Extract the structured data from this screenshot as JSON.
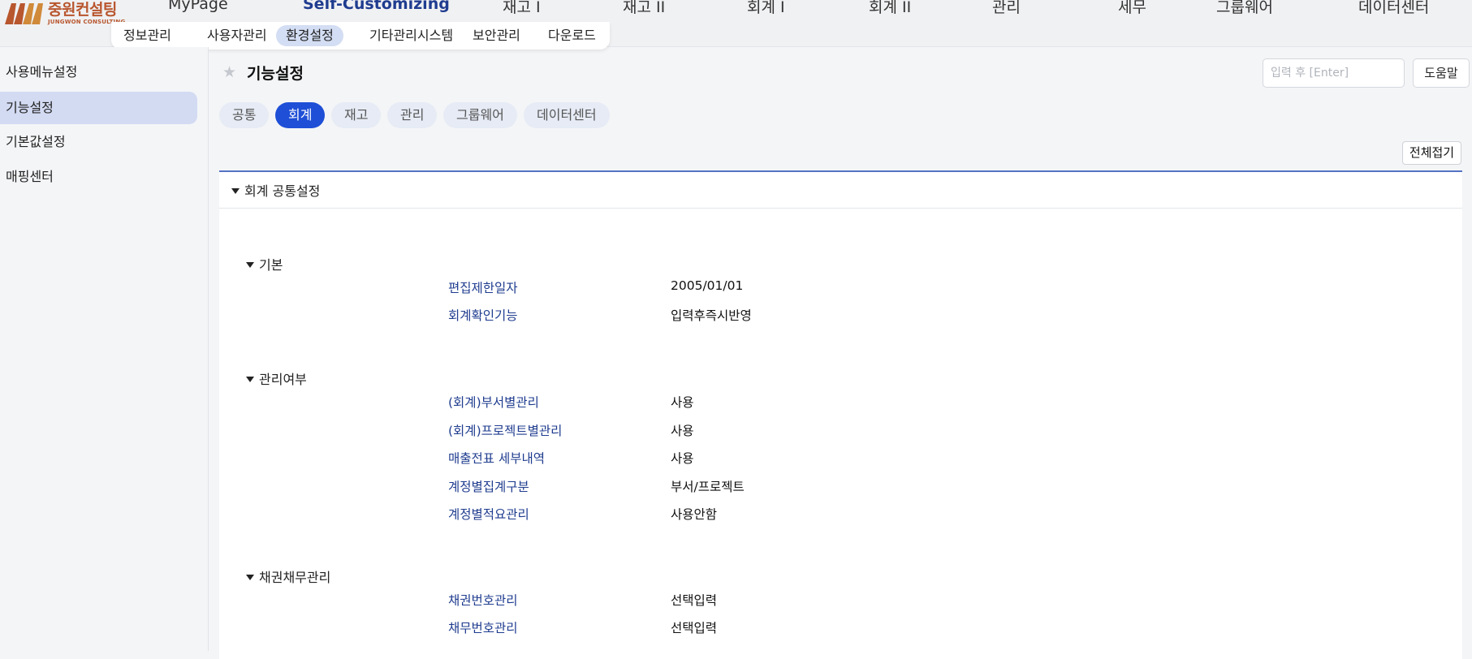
{
  "logo": {
    "name_ko": "중원컨설팅",
    "name_en": "JUNGWON CONSULTING"
  },
  "main_nav": [
    {
      "label": "MyPage",
      "active": false
    },
    {
      "label": "Self-Customizing",
      "active": true
    },
    {
      "label": "재고 I",
      "active": false
    },
    {
      "label": "재고 II",
      "active": false
    },
    {
      "label": "회계 I",
      "active": false
    },
    {
      "label": "회계 II",
      "active": false
    },
    {
      "label": "관리",
      "active": false
    },
    {
      "label": "세무",
      "active": false
    },
    {
      "label": "그룹웨어",
      "active": false
    },
    {
      "label": "데이터센터",
      "active": false
    }
  ],
  "sub_nav": [
    {
      "label": "정보관리",
      "active": false
    },
    {
      "label": "사용자관리",
      "active": false
    },
    {
      "label": "환경설정",
      "active": true
    },
    {
      "label": "기타관리시스템",
      "active": false
    },
    {
      "label": "보안관리",
      "active": false
    },
    {
      "label": "다운로드",
      "active": false
    }
  ],
  "sidebar": [
    {
      "label": "사용메뉴설정",
      "active": false
    },
    {
      "label": "기능설정",
      "active": true
    },
    {
      "label": "기본값설정",
      "active": false
    },
    {
      "label": "매핑센터",
      "active": false
    }
  ],
  "page": {
    "title": "기능설정",
    "search_placeholder": "입력 후 [Enter]",
    "help_label": "도움말",
    "collapse_all_label": "전체접기"
  },
  "tabs": [
    {
      "label": "공통",
      "active": false
    },
    {
      "label": "회계",
      "active": true
    },
    {
      "label": "재고",
      "active": false
    },
    {
      "label": "관리",
      "active": false
    },
    {
      "label": "그룹웨어",
      "active": false
    },
    {
      "label": "데이터센터",
      "active": false
    }
  ],
  "panel": {
    "title": "회계 공통설정",
    "groups": [
      {
        "title": "기본",
        "rows": [
          {
            "label": "편집제한일자",
            "value": "2005/01/01"
          },
          {
            "label": "회계확인기능",
            "value": "입력후즉시반영"
          }
        ]
      },
      {
        "title": "관리여부",
        "rows": [
          {
            "label": "(회계)부서별관리",
            "value": "사용"
          },
          {
            "label": "(회계)프로젝트별관리",
            "value": "사용"
          },
          {
            "label": "매출전표 세부내역",
            "value": "사용"
          },
          {
            "label": "계정별집계구분",
            "value": "부서/프로젝트"
          },
          {
            "label": "계정별적요관리",
            "value": "사용안함"
          }
        ]
      },
      {
        "title": "채권채무관리",
        "rows": [
          {
            "label": "채권번호관리",
            "value": "선택입력"
          },
          {
            "label": "채무번호관리",
            "value": "선택입력"
          }
        ]
      }
    ]
  },
  "colors": {
    "accent": "#1e4fd6",
    "nav_active": "#1f3c8f",
    "label_text": "#1f3c8f",
    "brand": "#b8562e"
  }
}
